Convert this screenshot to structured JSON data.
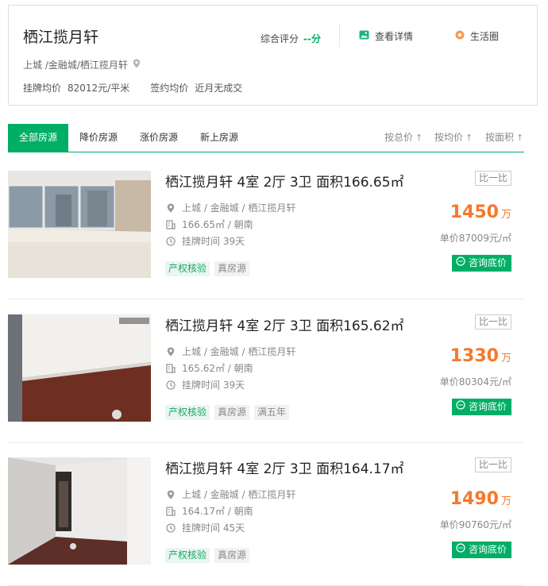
{
  "header": {
    "title": "栖江揽月轩",
    "location": "上城 /金融城/栖江揽月轩",
    "list_price_label": "挂牌均价",
    "list_price_value": "82012元/平米",
    "deal_price_label": "签约均价",
    "deal_price_value": "近月无成交",
    "score_label": "综合评分",
    "score_value": "--分",
    "detail_label": "查看详情",
    "life_label": "生活圈"
  },
  "tabs": {
    "all": "全部房源",
    "down": "降价房源",
    "up": "涨价房源",
    "new": "新上房源",
    "sort_total": "按总价",
    "sort_unit": "按均价",
    "sort_area": "按面积"
  },
  "listings": [
    {
      "title": "栖江揽月轩 4室 2厅 3卫 面积166.65㎡",
      "location": "上城 / 金融城 / 栖江揽月轩",
      "layout": "166.65㎡ / 朝南",
      "listed": "挂牌时间 39天",
      "tags": [
        "产权核验",
        "真房源"
      ],
      "compare": "比一比",
      "price": "1450",
      "price_unit": "万",
      "unit_price": "单价87009元/㎡",
      "consult": "咨询底价"
    },
    {
      "title": "栖江揽月轩 4室 2厅 3卫 面积165.62㎡",
      "location": "上城 / 金融城 / 栖江揽月轩",
      "layout": "165.62㎡ / 朝南",
      "listed": "挂牌时间 39天",
      "tags": [
        "产权核验",
        "真房源",
        "满五年"
      ],
      "compare": "比一比",
      "price": "1330",
      "price_unit": "万",
      "unit_price": "单价80304元/㎡",
      "consult": "咨询底价"
    },
    {
      "title": "栖江揽月轩 4室 2厅 3卫 面积164.17㎡",
      "location": "上城 / 金融城 / 栖江揽月轩",
      "layout": "164.17㎡ / 朝南",
      "listed": "挂牌时间 45天",
      "tags": [
        "产权核验",
        "真房源"
      ],
      "compare": "比一比",
      "price": "1490",
      "price_unit": "万",
      "unit_price": "单价90760元/㎡",
      "consult": "咨询底价"
    }
  ],
  "colors": {
    "accent": "#00ae66",
    "price": "#f5782a"
  },
  "icons": {
    "location": "location-pin-icon",
    "layout": "building-icon",
    "time": "clock-icon",
    "detail": "photo-icon",
    "life": "life-circle-icon",
    "consult": "chat-icon",
    "sort": "up-arrow-icon"
  }
}
